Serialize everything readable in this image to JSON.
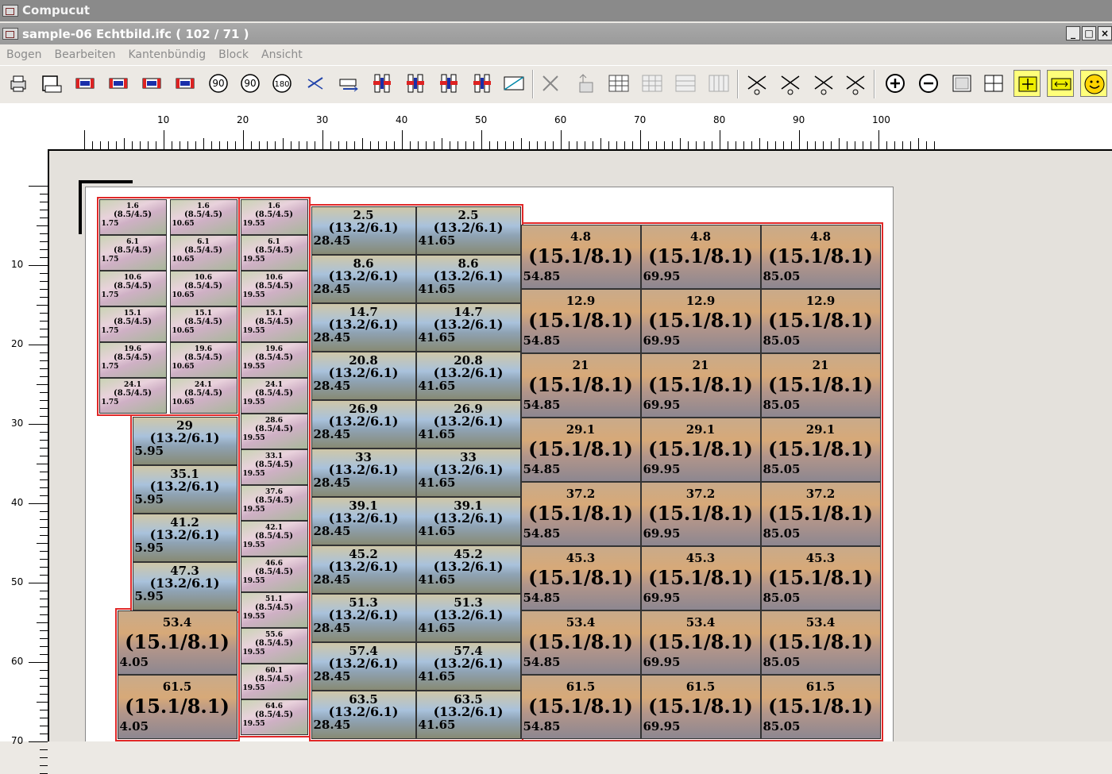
{
  "window": {
    "app_title": "Compucut",
    "doc_title": "sample-06 Echtbild.ifc ( 102 / 71 )",
    "controls": {
      "minimize": "_",
      "maximize": "□",
      "close": "×"
    }
  },
  "menu": [
    "Bogen",
    "Bearbeiten",
    "Kantenbündig",
    "Block",
    "Ansicht"
  ],
  "toolbar": {
    "items": [
      {
        "icon": "printer-icon"
      },
      {
        "icon": "sheet-size-icon"
      },
      {
        "icon": "label-red-blue-icon-1"
      },
      {
        "icon": "label-red-blue-icon-2"
      },
      {
        "icon": "label-red-blue-icon-3"
      },
      {
        "icon": "label-red-blue-icon-4"
      },
      {
        "icon": "rotate-90-cw-icon",
        "text": "90"
      },
      {
        "icon": "rotate-90-ccw-icon",
        "text": "90"
      },
      {
        "icon": "rotate-180-icon",
        "text": "180"
      },
      {
        "icon": "mirror-icon"
      },
      {
        "icon": "align-arrow-icon"
      },
      {
        "icon": "align-left-icon"
      },
      {
        "icon": "align-top-icon"
      },
      {
        "icon": "align-center-h-icon"
      },
      {
        "icon": "align-center-v-icon"
      },
      {
        "icon": "frame-icon"
      },
      {
        "icon": "delete-icon"
      },
      {
        "icon": "insert-row-icon"
      },
      {
        "icon": "grid-icon"
      },
      {
        "icon": "grid-disabled-icon"
      },
      {
        "icon": "rows-icon"
      },
      {
        "icon": "columns-icon"
      },
      {
        "icon": "cut-marks-icon"
      },
      {
        "icon": "cut-vertical-icon"
      },
      {
        "icon": "cut-horizontal-icon"
      },
      {
        "icon": "cut-frame-icon"
      },
      {
        "icon": "zoom-in-icon"
      },
      {
        "icon": "zoom-out-icon"
      },
      {
        "icon": "page-view-icon"
      },
      {
        "icon": "fit-view-icon"
      },
      {
        "icon": "move-mode-icon",
        "selected": true
      },
      {
        "icon": "spacing-mode-icon",
        "selected": true
      },
      {
        "icon": "smiley-icon",
        "selected": true
      }
    ]
  },
  "rulers": {
    "horizontal": [
      10,
      20,
      30,
      40,
      50,
      60,
      70,
      80,
      90,
      100
    ],
    "vertical": [
      10,
      20,
      30,
      40,
      50,
      60,
      70
    ]
  },
  "labels": {
    "small": {
      "size": "(8.5/4.5)",
      "cols": [
        {
          "x": "1.75",
          "ys": [
            "1.6",
            "6.1",
            "10.6",
            "15.1",
            "19.6",
            "24.1"
          ]
        },
        {
          "x": "10.65",
          "ys": [
            "1.6",
            "6.1",
            "10.6",
            "15.1",
            "19.6",
            "24.1"
          ]
        },
        {
          "x": "19.55",
          "ys": [
            "1.6",
            "6.1",
            "10.6",
            "15.1",
            "19.6",
            "24.1",
            "28.6",
            "33.1",
            "37.6",
            "42.1",
            "46.6",
            "51.1",
            "55.6",
            "60.1",
            "64.6"
          ]
        }
      ]
    },
    "medium": {
      "size": "(13.2/6.1)",
      "cols": [
        {
          "x": "5.95",
          "ys": [
            "29",
            "35.1",
            "41.2",
            "47.3"
          ]
        },
        {
          "x": "28.45",
          "ys": [
            "2.5",
            "8.6",
            "14.7",
            "20.8",
            "26.9",
            "33",
            "39.1",
            "45.2",
            "51.3",
            "57.4",
            "63.5"
          ]
        },
        {
          "x": "41.65",
          "ys": [
            "2.5",
            "8.6",
            "14.7",
            "20.8",
            "26.9",
            "33",
            "39.1",
            "45.2",
            "51.3",
            "57.4",
            "63.5"
          ]
        }
      ]
    },
    "large": {
      "size": "(15.1/8.1)",
      "cols": [
        {
          "x": "4.05",
          "ys": [
            "53.4",
            "61.5"
          ]
        },
        {
          "x": "54.85",
          "ys": [
            "4.8",
            "12.9",
            "21",
            "29.1",
            "37.2",
            "45.3",
            "53.4",
            "61.5"
          ]
        },
        {
          "x": "69.95",
          "ys": [
            "4.8",
            "12.9",
            "21",
            "29.1",
            "37.2",
            "45.3",
            "53.4",
            "61.5"
          ]
        },
        {
          "x": "85.05",
          "ys": [
            "4.8",
            "12.9",
            "21",
            "29.1",
            "37.2",
            "45.3",
            "53.4",
            "61.5"
          ]
        }
      ]
    },
    "side_mark": "0"
  }
}
